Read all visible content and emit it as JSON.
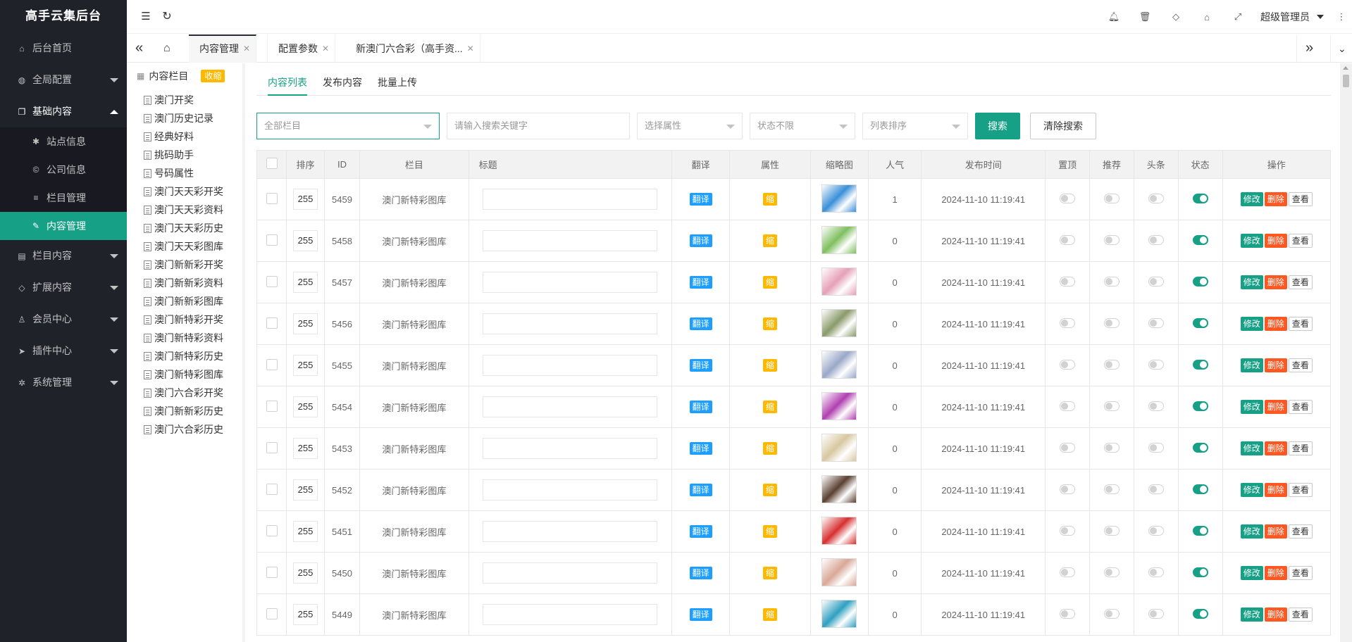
{
  "app_title": "高手云集后台",
  "sidebar": {
    "items": [
      {
        "label": "后台首页",
        "icon": "home-icon",
        "glyph": "⌂",
        "arrow": false
      },
      {
        "label": "全局配置",
        "icon": "globe-icon",
        "glyph": "◍",
        "arrow": true
      },
      {
        "label": "基础内容",
        "icon": "copy-icon",
        "glyph": "❐",
        "arrow": true,
        "open": true
      }
    ],
    "sub_items": [
      {
        "label": "站点信息",
        "icon": "gear-icon",
        "glyph": "✱"
      },
      {
        "label": "公司信息",
        "icon": "copyright-icon",
        "glyph": "©"
      },
      {
        "label": "栏目管理",
        "icon": "list-icon",
        "glyph": "≡"
      },
      {
        "label": "内容管理",
        "icon": "edit-icon",
        "glyph": "✎",
        "active": true
      }
    ],
    "more_items": [
      {
        "label": "栏目内容",
        "icon": "file-icon",
        "glyph": "▤"
      },
      {
        "label": "扩展内容",
        "icon": "code-icon",
        "glyph": "◇"
      },
      {
        "label": "会员中心",
        "icon": "user-icon",
        "glyph": "♙"
      },
      {
        "label": "插件中心",
        "icon": "send-icon",
        "glyph": "➤"
      },
      {
        "label": "系统管理",
        "icon": "gears-icon",
        "glyph": "✲"
      }
    ]
  },
  "header": {
    "user_name": "超级管理员",
    "icons": [
      "bell-icon",
      "trash-icon",
      "tag-icon",
      "home-icon",
      "fullscreen-icon"
    ]
  },
  "tabs": [
    {
      "label": "内容管理",
      "active": true
    },
    {
      "label": "配置参数",
      "active": false
    },
    {
      "label": "新澳门六合彩（高手资...",
      "active": false
    }
  ],
  "tree": {
    "title": "内容栏目",
    "collapse_label": "收缩",
    "items": [
      "澳门开奖",
      "澳门历史记录",
      "经典好料",
      "挑码助手",
      "号码属性",
      "澳门天天彩开奖",
      "澳门天天彩资料",
      "澳门天天彩历史",
      "澳门天天彩图库",
      "澳门新新彩开奖",
      "澳门新新彩资料",
      "澳门新新彩图库",
      "澳门新特彩开奖",
      "澳门新特彩资料",
      "澳门新特彩历史",
      "澳门新特彩图库",
      "澳门六合彩开奖",
      "澳门新新彩历史",
      "澳门六合彩历史"
    ]
  },
  "content_tabs": [
    {
      "label": "内容列表",
      "active": true
    },
    {
      "label": "发布内容",
      "active": false
    },
    {
      "label": "批量上传",
      "active": false
    }
  ],
  "search": {
    "category_select": "全部栏目",
    "keyword_placeholder": "请输入搜索关键字",
    "attr_select": "选择属性",
    "status_select": "状态不限",
    "sort_select": "列表排序",
    "search_button": "搜索",
    "clear_button": "清除搜索"
  },
  "table": {
    "headers": [
      "排序",
      "ID",
      "栏目",
      "标题",
      "翻译",
      "属性",
      "缩略图",
      "人气",
      "发布时间",
      "置顶",
      "推荐",
      "头条",
      "状态",
      "操作"
    ],
    "translate_label": "翻译",
    "attr_label": "缩",
    "edit_label": "修改",
    "delete_label": "删除",
    "view_label": "查看",
    "rows": [
      {
        "order": "255",
        "id": "5459",
        "category": "澳门新特彩图库",
        "views": "1",
        "time": "2024-11-10 11:19:41",
        "thumb_color": "#3a8fd8"
      },
      {
        "order": "255",
        "id": "5458",
        "category": "澳门新特彩图库",
        "views": "0",
        "time": "2024-11-10 11:19:41",
        "thumb_color": "#7fbf5f"
      },
      {
        "order": "255",
        "id": "5457",
        "category": "澳门新特彩图库",
        "views": "0",
        "time": "2024-11-10 11:19:41",
        "thumb_color": "#e6a0b8"
      },
      {
        "order": "255",
        "id": "5456",
        "category": "澳门新特彩图库",
        "views": "0",
        "time": "2024-11-10 11:19:41",
        "thumb_color": "#8a9a6a"
      },
      {
        "order": "255",
        "id": "5455",
        "category": "澳门新特彩图库",
        "views": "0",
        "time": "2024-11-10 11:19:41",
        "thumb_color": "#9aa8c8"
      },
      {
        "order": "255",
        "id": "5454",
        "category": "澳门新特彩图库",
        "views": "0",
        "time": "2024-11-10 11:19:41",
        "thumb_color": "#b040b0"
      },
      {
        "order": "255",
        "id": "5453",
        "category": "澳门新特彩图库",
        "views": "0",
        "time": "2024-11-10 11:19:41",
        "thumb_color": "#d8c8a0"
      },
      {
        "order": "255",
        "id": "5452",
        "category": "澳门新特彩图库",
        "views": "0",
        "time": "2024-11-10 11:19:41",
        "thumb_color": "#5a4030"
      },
      {
        "order": "255",
        "id": "5451",
        "category": "澳门新特彩图库",
        "views": "0",
        "time": "2024-11-10 11:19:41",
        "thumb_color": "#d83030"
      },
      {
        "order": "255",
        "id": "5450",
        "category": "澳门新特彩图库",
        "views": "0",
        "time": "2024-11-10 11:19:41",
        "thumb_color": "#d8a898"
      },
      {
        "order": "255",
        "id": "5449",
        "category": "澳门新特彩图库",
        "views": "0",
        "time": "2024-11-10 11:19:41",
        "thumb_color": "#30a0c0"
      }
    ]
  },
  "colors": {
    "accent": "#16a085",
    "sidebar_bg": "#20222a",
    "blue_tag": "#1e9fff",
    "yellow_tag": "#ffb800",
    "delete": "#ff5722"
  }
}
